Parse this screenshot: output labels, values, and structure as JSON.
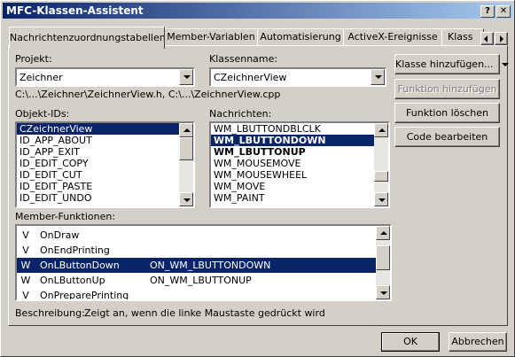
{
  "window": {
    "title": "MFC-Klassen-Assistent",
    "help": "?",
    "close": "✕"
  },
  "tabs": [
    {
      "label": "Nachrichtenzuordnungstabellen"
    },
    {
      "label": "Member-Variablen"
    },
    {
      "label": "Automatisierung"
    },
    {
      "label": "ActiveX-Ereignisse"
    },
    {
      "label": "Klass"
    }
  ],
  "project": {
    "label": "Projekt:",
    "value": "Zeichner"
  },
  "classname": {
    "label": "Klassenname:",
    "value": "CZeichnerView"
  },
  "filepath": "C:\\...\\Zeichner\\ZeichnerView.h, C:\\...\\ZeichnerView.cpp",
  "objects": {
    "label": "Objekt-IDs:",
    "items": [
      "CZeichnerView",
      "ID_APP_ABOUT",
      "ID_APP_EXIT",
      "ID_EDIT_COPY",
      "ID_EDIT_CUT",
      "ID_EDIT_PASTE",
      "ID_EDIT_UNDO"
    ]
  },
  "messages": {
    "label": "Nachrichten:",
    "items": [
      "WM_LBUTTONDBLCLK",
      "WM_LBUTTONDOWN",
      "WM_LBUTTONUP",
      "WM_MOUSEMOVE",
      "WM_MOUSEWHEEL",
      "WM_MOVE",
      "WM_PAINT"
    ]
  },
  "buttons": {
    "add_class": "Klasse hinzufügen...",
    "add_function": "Funktion hinzufügen",
    "delete_function": "Funktion löschen",
    "edit_code": "Code bearbeiten",
    "ok": "OK",
    "cancel": "Abbrechen"
  },
  "members": {
    "label": "Member-Funktionen:",
    "items": [
      {
        "kind": "V",
        "name": "OnDraw",
        "handler": ""
      },
      {
        "kind": "V",
        "name": "OnEndPrinting",
        "handler": ""
      },
      {
        "kind": "W",
        "name": "OnLButtonDown",
        "handler": "ON_WM_LBUTTONDOWN"
      },
      {
        "kind": "W",
        "name": "OnLButtonUp",
        "handler": "ON_WM_LBUTTONUP"
      },
      {
        "kind": "V",
        "name": "OnPreparePrinting",
        "handler": ""
      }
    ]
  },
  "description": {
    "label": "Beschreibung:",
    "text": "Zeigt an, wenn die linke Maustaste gedrückt wird"
  }
}
